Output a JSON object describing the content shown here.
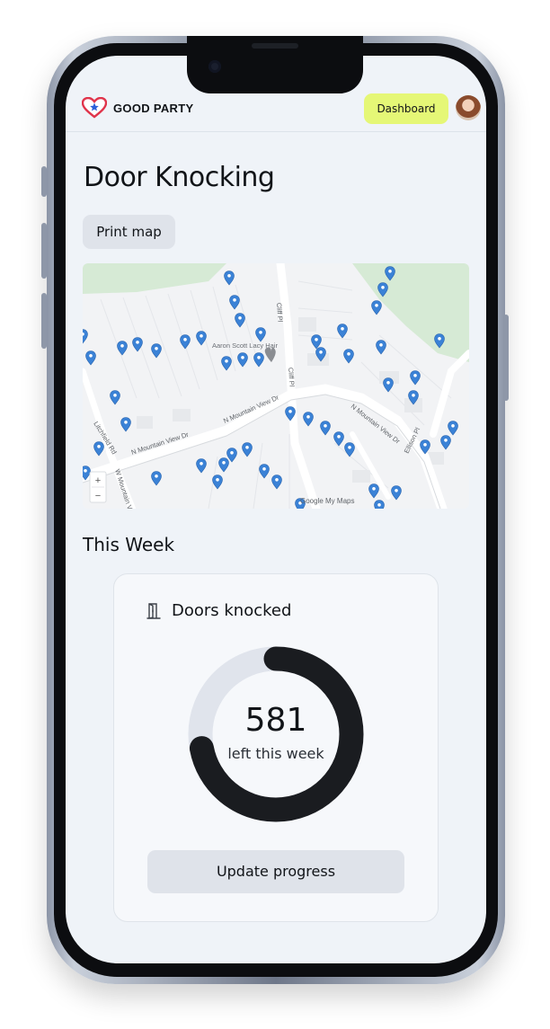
{
  "header": {
    "logo_text": "GOOD PARTY",
    "dashboard_label": "Dashboard"
  },
  "page": {
    "title": "Door Knocking",
    "print_map_label": "Print map"
  },
  "map": {
    "poi_label": "Aaron Scott Lacy Hair",
    "streets": [
      "Cliff Pl",
      "Cliff Pl",
      "N Mountain View Dr",
      "N Mountain View Dr",
      "N Mountain View Dr",
      "Ellison Pl",
      "Litchfield Rd",
      "W Mountain Vi"
    ],
    "attribution": "Google My Maps",
    "zoom_in": "+",
    "zoom_out": "−",
    "pin_color": "#3b82d6",
    "park_color": "#d6ead5"
  },
  "section": {
    "this_week": "This Week"
  },
  "card": {
    "title": "Doors knocked",
    "count": "581",
    "subtitle": "left this week",
    "progress_fraction": 0.72,
    "progress_color": "#1a1c20",
    "track_color": "#e0e4ec",
    "update_label": "Update progress"
  }
}
